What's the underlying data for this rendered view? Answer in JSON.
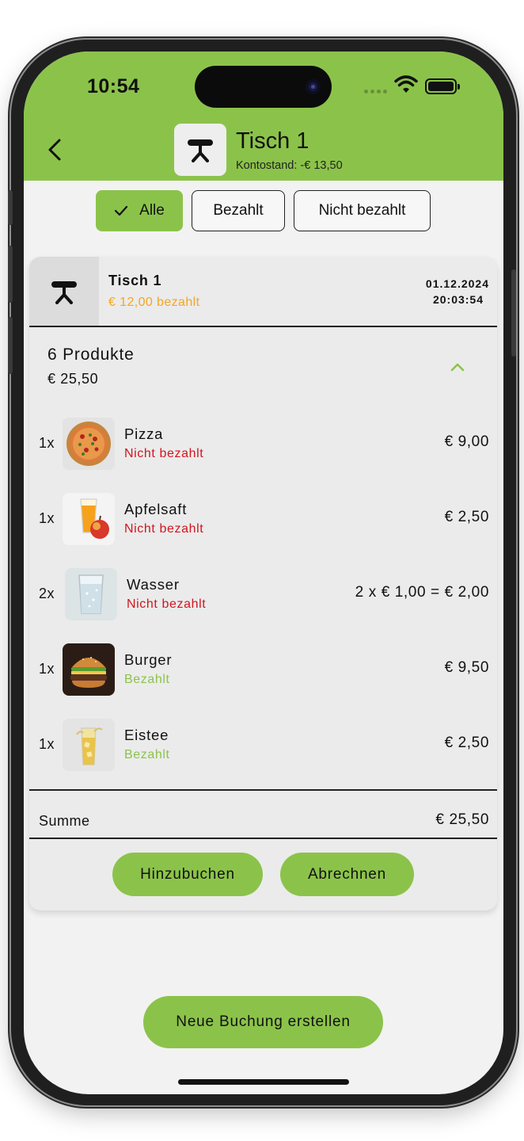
{
  "status_bar": {
    "time": "10:54"
  },
  "header": {
    "title": "Tisch 1",
    "balance": "Kontostand: -€ 13,50"
  },
  "filters": [
    {
      "label": "Alle",
      "active": true
    },
    {
      "label": "Bezahlt",
      "active": false
    },
    {
      "label": "Nicht bezahlt",
      "active": false
    }
  ],
  "booking": {
    "title": "Tisch 1",
    "paid": "€ 12,00 bezahlt",
    "date": "01.12.2024",
    "time": "20:03:54",
    "products_count": "6 Produkte",
    "products_total": "€ 25,50",
    "items": [
      {
        "qty": "1x",
        "name": "Pizza",
        "status": "Nicht bezahlt",
        "price": "€ 9,00",
        "image": "pizza"
      },
      {
        "qty": "1x",
        "name": "Apfelsaft",
        "status": "Nicht bezahlt",
        "price": "€ 2,50",
        "image": "apple-juice"
      },
      {
        "qty": "2x",
        "name": "Wasser",
        "status": "Nicht bezahlt",
        "price": "2 x € 1,00 = € 2,00",
        "image": "water-glass"
      },
      {
        "qty": "1x",
        "name": "Burger",
        "status": "Bezahlt",
        "price": "€ 9,50",
        "image": "burger"
      },
      {
        "qty": "1x",
        "name": "Eistee",
        "status": "Bezahlt",
        "price": "€ 2,50",
        "image": "iced-tea"
      }
    ],
    "sum_label": "Summe",
    "sum_value": "€ 25,50",
    "add_button": "Hinzubuchen",
    "checkout_button": "Abrechnen"
  },
  "new_booking_button": "Neue Buchung erstellen",
  "colors": {
    "brand_green": "#8bc34a",
    "unpaid_red": "#d0161f",
    "paid_green": "#8bc34a",
    "partial_orange": "#f5a623"
  }
}
